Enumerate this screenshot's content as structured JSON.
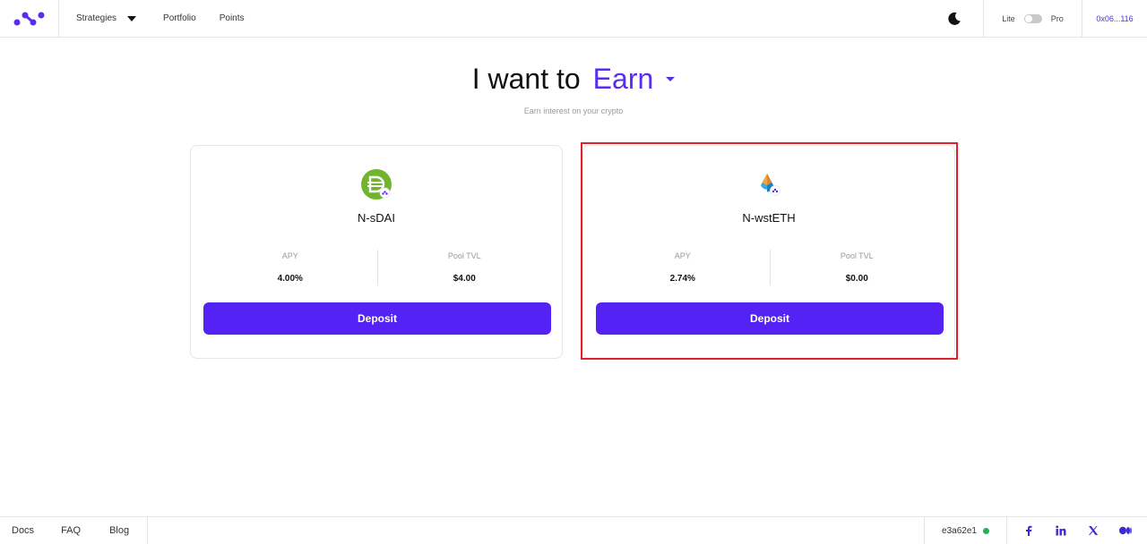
{
  "header": {
    "logo_icon": "app-logo-icon",
    "nav": {
      "strategies": "Strategies",
      "portfolio": "Portfolio",
      "points": "Points"
    },
    "theme_icon": "moon-icon",
    "mode": {
      "lite": "Lite",
      "pro": "Pro",
      "pro_enabled": false
    },
    "wallet": "0x06...116"
  },
  "hero": {
    "prefix": "I want to",
    "action": "Earn",
    "subtitle": "Earn interest on your crypto"
  },
  "cards": [
    {
      "name": "N-sDAI",
      "icon": "sdai-token-icon",
      "apy_label": "APY",
      "apy": "4.00%",
      "tvl_label": "Pool TVL",
      "tvl": "$4.00",
      "button": "Deposit"
    },
    {
      "name": "N-wstETH",
      "icon": "wsteth-token-icon",
      "apy_label": "APY",
      "apy": "2.74%",
      "tvl_label": "Pool TVL",
      "tvl": "$0.00",
      "button": "Deposit",
      "highlighted": true
    }
  ],
  "footer": {
    "links": {
      "docs": "Docs",
      "faq": "FAQ",
      "blog": "Blog"
    },
    "build": "e3a62e1",
    "social_icons": [
      "facebook-icon",
      "linkedin-icon",
      "x-icon",
      "medium-icon"
    ]
  },
  "colors": {
    "accent": "#5522f5",
    "highlight": "#e0202a",
    "status_ok": "#21b35a"
  }
}
